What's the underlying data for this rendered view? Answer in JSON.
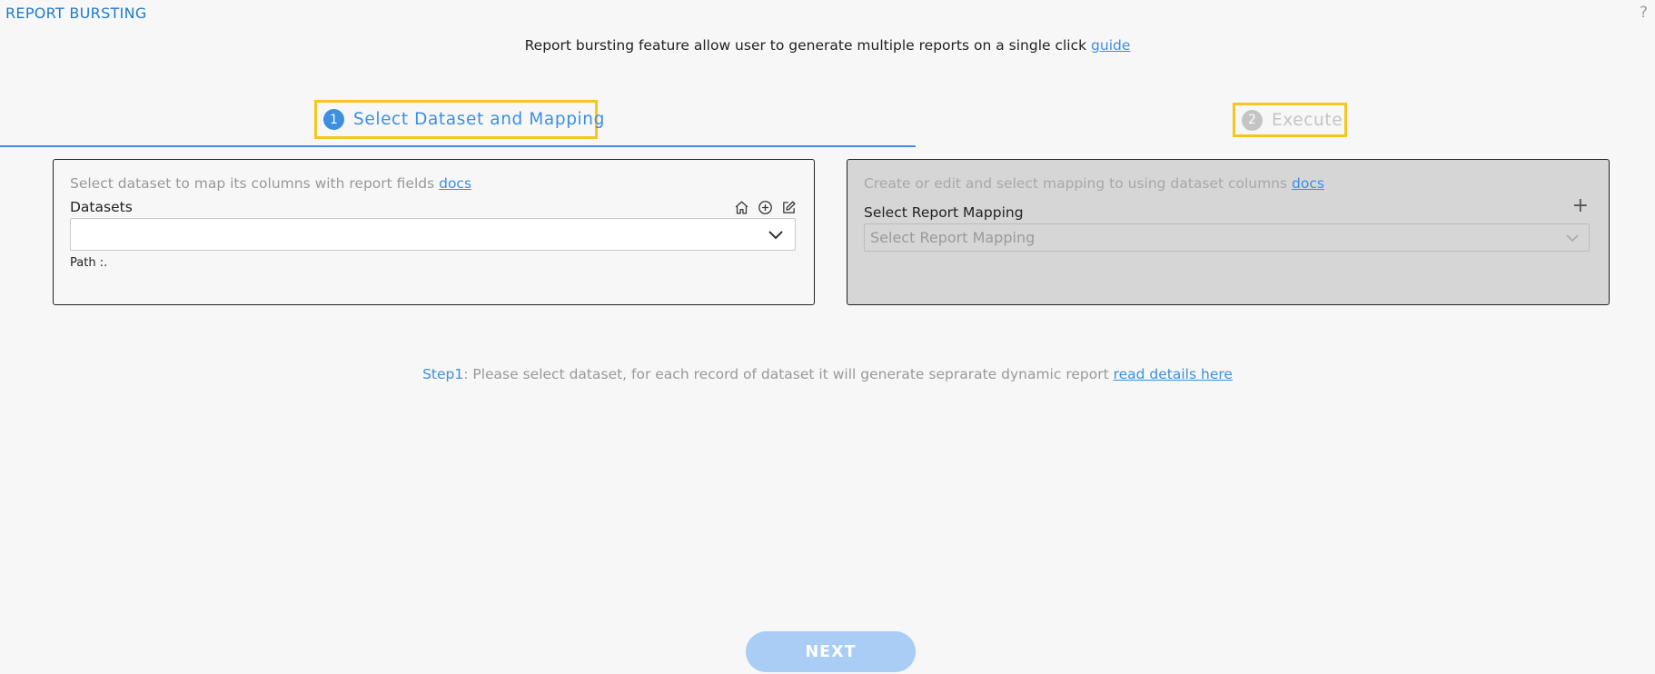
{
  "header": {
    "title": "REPORT BURSTING",
    "help": "?",
    "subtitle": "Report bursting feature allow user to generate multiple reports on a single click",
    "guide_link": "guide"
  },
  "steps": [
    {
      "number": "1",
      "label": "Select Dataset and Mapping",
      "active": true
    },
    {
      "number": "2",
      "label": "Execute",
      "active": false
    }
  ],
  "dataset_panel": {
    "hint": "Select dataset to map its columns with report fields",
    "docs_link": "docs",
    "datasets_label": "Datasets",
    "selected_value": "",
    "path_label": "Path :.",
    "icons": [
      "home-icon",
      "add-circle-icon",
      "edit-icon"
    ]
  },
  "mapping_panel": {
    "hint": "Create or edit and select mapping to using dataset columns",
    "docs_link": "docs",
    "label": "Select Report Mapping",
    "placeholder": "Select Report Mapping",
    "add_symbol": "+"
  },
  "instruction": {
    "prefix": "Step1",
    "text": ": Please select dataset, for each record of dataset it will generate seprarate dynamic report",
    "link": "read details here"
  },
  "footer": {
    "next_label": "NEXT"
  },
  "colors": {
    "accent": "#3d8fe0",
    "highlight": "#f7c61e",
    "title": "#1f7ac8",
    "disabled_panel": "#d6d6d6",
    "next_button": "#a9cdf5"
  }
}
